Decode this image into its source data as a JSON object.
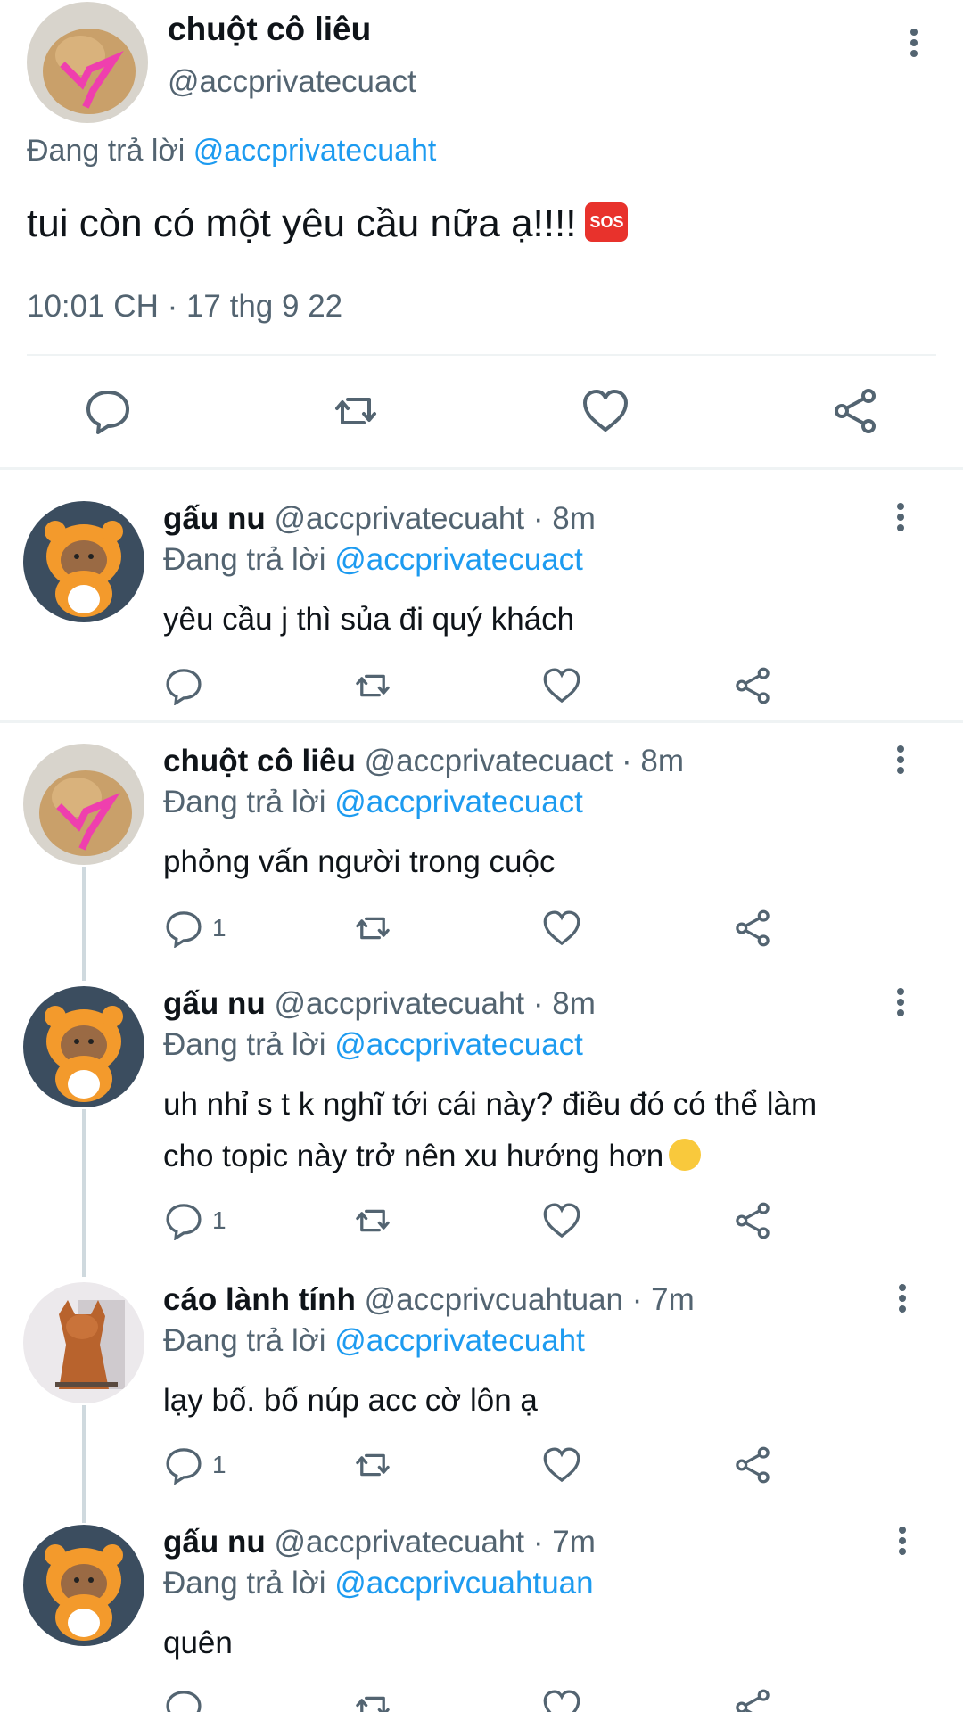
{
  "main": {
    "name": "chuột cô liêu",
    "handle": "@accprivatecuact",
    "reply_prefix": "Đang trả lời",
    "reply_to": "@accprivatecuaht",
    "text": "tui còn có một yêu cầu nữa ạ!!!!",
    "emoji": "SOS",
    "timestamp": "10:01 CH · 17 thg 9 22"
  },
  "replies": [
    {
      "name": "gấu nu",
      "meta": "@accprivatecuaht · 8m",
      "reply_prefix": "Đang trả lời",
      "reply_to": "@accprivatecuact",
      "text": "yêu cầu j thì sủa đi quý khách",
      "reply_count": ""
    },
    {
      "name": "chuột cô liêu",
      "meta": "@accprivatecuact · 8m",
      "reply_prefix": "Đang trả lời",
      "reply_to": "@accprivatecuact",
      "text": "phỏng vấn người trong cuộc",
      "reply_count": "1"
    },
    {
      "name": "gấu nu",
      "meta": "@accprivatecuaht · 8m",
      "reply_prefix": "Đang trả lời",
      "reply_to": "@accprivatecuact",
      "text_line1": "uh nhỉ s t k nghĩ tới cái này? điều đó có thể làm",
      "text_line2": "cho topic này trở nên xu hướng hơn",
      "reply_count": "1"
    },
    {
      "name": "cáo lành tính",
      "meta": "@accprivcuahtuan · 7m",
      "reply_prefix": "Đang trả lời",
      "reply_to": "@accprivatecuaht",
      "text": "lạy bố. bố núp acc cờ lôn ạ",
      "reply_count": "1"
    },
    {
      "name": "gấu nu",
      "meta": "@accprivatecuaht · 7m",
      "reply_prefix": "Đang trả lời",
      "reply_to": "@accprivcuahtuan",
      "text": "quên",
      "reply_count": ""
    }
  ],
  "colors": {
    "link": "#1d9bf0",
    "muted": "#536471",
    "icon": "#536471",
    "divider": "#eff3f4"
  }
}
